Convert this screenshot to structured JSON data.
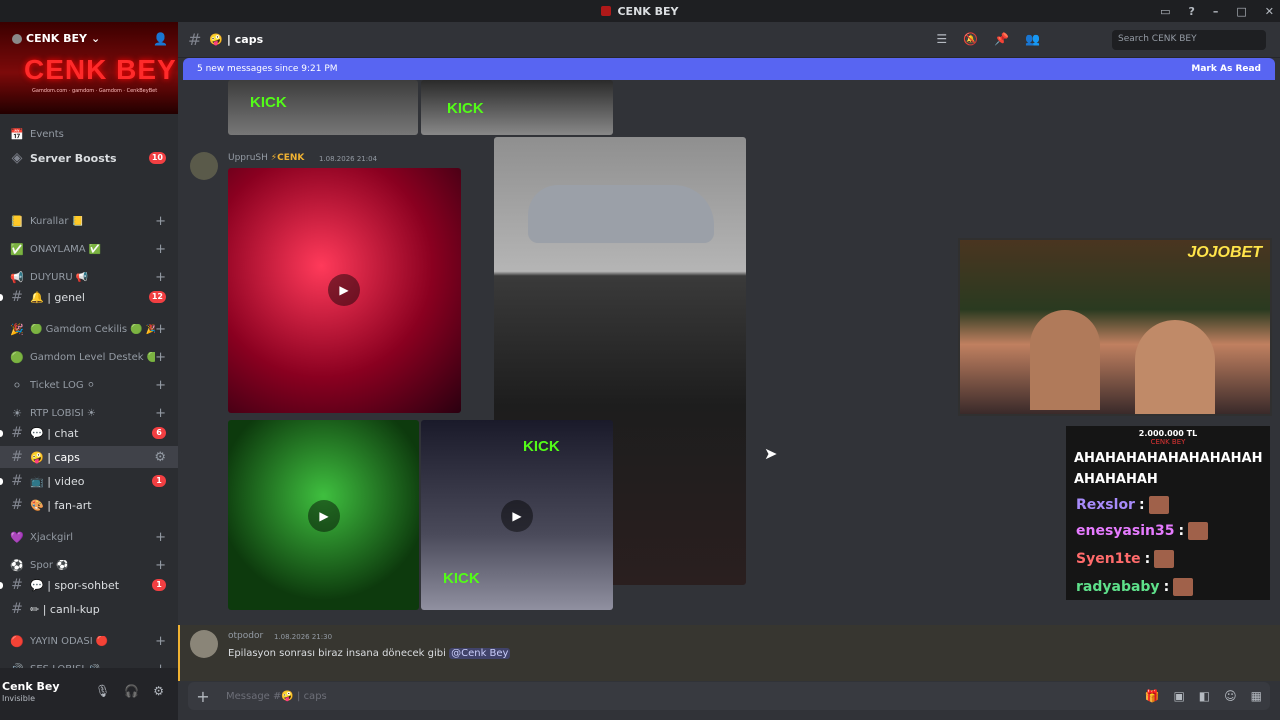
{
  "window": {
    "title": "CENK BEY",
    "controls": [
      "▭",
      "?",
      "–",
      "□",
      "✕"
    ]
  },
  "server": {
    "name": "CENK BEY",
    "banner_title": "CENK BEY",
    "banner_small": "Gamdom.com · gamdom · Gamdom · CenkBeyBet"
  },
  "sidebar": {
    "events_label": "Events",
    "boosts_label": "Server Boosts",
    "boosts_count": "10",
    "items": [
      {
        "icon": "📒",
        "label": "Kurallar 📒",
        "type": "cat"
      },
      {
        "icon": "✅",
        "label": "ONAYLAMA ✅",
        "type": "cat"
      },
      {
        "icon": "📢",
        "label": "DUYURU 📢",
        "type": "cat"
      },
      {
        "icon": "#",
        "label": "🔔 | genel",
        "type": "ch",
        "badge": "12"
      },
      {
        "icon": "🎉",
        "label": "🟢 Gamdom Cekilis 🟢 🎉",
        "type": "cat"
      },
      {
        "icon": "🟢",
        "label": "Gamdom Level Destek 🟢",
        "type": "cat"
      },
      {
        "icon": "⚪",
        "label": "Ticket LOG ⚪",
        "type": "cat"
      },
      {
        "icon": "☀",
        "label": "RTP LOBİSİ ☀",
        "type": "cat"
      },
      {
        "icon": "#",
        "label": "💬 | chat",
        "type": "ch",
        "badge": "6"
      },
      {
        "icon": "#",
        "label": "🤪 | caps",
        "type": "ch",
        "active": true
      },
      {
        "icon": "#",
        "label": "📺 | video",
        "type": "ch",
        "badge": "1"
      },
      {
        "icon": "#",
        "label": "🎨 | fan-art",
        "type": "ch"
      },
      {
        "icon": "💜",
        "label": "Xjackgirl",
        "type": "cat"
      },
      {
        "icon": "⚽",
        "label": "Spor ⚽",
        "type": "cat"
      },
      {
        "icon": "#",
        "label": "💬 | spor-sohbet",
        "type": "ch",
        "badge": "1"
      },
      {
        "icon": "#",
        "label": "✏ | canlı-kup",
        "type": "ch"
      },
      {
        "icon": "🔴",
        "label": "YAYIN ODASI 🔴",
        "type": "cat"
      },
      {
        "icon": "🔊",
        "label": "SES LOBİSİ 🔊",
        "type": "cat"
      }
    ]
  },
  "user": {
    "name": "Cenk Bey",
    "status": "Invisible"
  },
  "channel": {
    "name": "🤪 | caps",
    "search_placeholder": "Search CENK BEY"
  },
  "newbar": {
    "text": "5 new messages since 9:21 PM",
    "mark": "Mark As Read"
  },
  "messages": [
    {
      "author": "UppruSH",
      "role": "⚡CENK",
      "time": "1.08.2026 21:04"
    },
    {
      "author": "otpodor",
      "time": "1.08.2026 21:30",
      "text": "Epilasyon sonrası biraz insana dönecek gibi ",
      "mention": "@Cenk Bey"
    }
  ],
  "media": {
    "kick": "KICK",
    "kick_url": "KICK.COM/CENKBEYRESMI",
    "play": "▶"
  },
  "composer": {
    "placeholder": "Message #🤪 | caps",
    "add": "+"
  },
  "stream": {
    "sponsor": "JOJOBET",
    "amount": "2.000.000 TL",
    "amount_sub": "CENK BEY",
    "shout": "AHAHAHAHAHAHAHAHAHAHAHAHAH",
    "chat": [
      {
        "user": "Rexslor",
        "color": "#a78bfa"
      },
      {
        "user": "enesyasin35",
        "color": "#e67bff"
      },
      {
        "user": "Syen1te",
        "color": "#ff6b6b"
      },
      {
        "user": "radyababy",
        "color": "#5ee08a"
      }
    ]
  }
}
